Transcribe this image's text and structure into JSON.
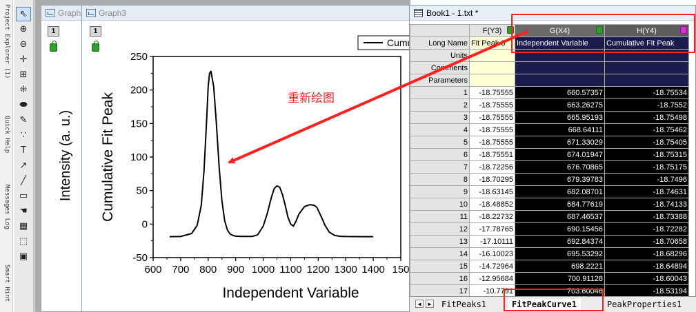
{
  "side_panels": [
    "Project Explorer (1)",
    "Quick Help",
    "Messages Log",
    "Smart Hint"
  ],
  "tools": [
    {
      "name": "pointer-icon",
      "glyph": "⇖"
    },
    {
      "name": "zoom-in-icon",
      "glyph": "⊕"
    },
    {
      "name": "zoom-out-icon",
      "glyph": "⊖"
    },
    {
      "name": "screen-reader-icon",
      "glyph": "✛"
    },
    {
      "name": "data-reader-icon",
      "glyph": "⊞"
    },
    {
      "name": "data-selector-icon",
      "glyph": "⁜"
    },
    {
      "name": "region-mask-icon",
      "glyph": "⬬"
    },
    {
      "name": "draw-data-icon",
      "glyph": "✎"
    },
    {
      "name": "scatter-icon",
      "glyph": "∵"
    },
    {
      "name": "text-tool-icon",
      "glyph": "T"
    },
    {
      "name": "arrow-tool-icon",
      "glyph": "↗"
    },
    {
      "name": "line-tool-icon",
      "glyph": "╱"
    },
    {
      "name": "rectangle-tool-icon",
      "glyph": "▭"
    },
    {
      "name": "hand-icon",
      "glyph": "☚"
    },
    {
      "name": "region-icon",
      "glyph": "▦"
    },
    {
      "name": "zoom-pan-icon",
      "glyph": "⬚"
    },
    {
      "name": "picture-icon",
      "glyph": "▣"
    }
  ],
  "graph2": {
    "title": "Graph",
    "layer": "1",
    "ylabel": "Intensity (a. u.)"
  },
  "graph3": {
    "title": "Graph3",
    "layer": "1",
    "legend": "Cumu"
  },
  "annotation_text": "重新绘图",
  "chart_data": {
    "type": "line",
    "title": "",
    "xlabel": "Independent Variable",
    "ylabel": "Cumulative Fit Peak",
    "xlim": [
      600,
      1500
    ],
    "ylim": [
      -50,
      250
    ],
    "xticks": [
      600,
      700,
      800,
      900,
      1000,
      1100,
      1200,
      1300,
      1400,
      1500
    ],
    "xtick_labels": [
      "600",
      "700",
      "800",
      "900",
      "1000",
      "1100",
      "1200",
      "1300",
      "1400",
      "150"
    ],
    "yticks": [
      -50,
      0,
      50,
      100,
      150,
      200,
      250
    ],
    "grid": false,
    "legend": "top-right",
    "series": [
      {
        "x": [
          660,
          700,
          740,
          760,
          775,
          785,
          795,
          800,
          805,
          810,
          820,
          830,
          840,
          850,
          860,
          870,
          880,
          890,
          900,
          920,
          940,
          960,
          980,
          1000,
          1015,
          1030,
          1040,
          1050,
          1060,
          1070,
          1080,
          1090,
          1100,
          1110,
          1120,
          1130,
          1150,
          1170,
          1185,
          1195,
          1210,
          1225,
          1240,
          1260,
          1280,
          1300,
          1330,
          1360,
          1400
        ],
        "y": [
          -18.8,
          -18.6,
          -14,
          -2,
          28,
          80,
          160,
          205,
          225,
          228,
          205,
          150,
          85,
          35,
          5,
          -9,
          -15,
          -17,
          -18,
          -18.4,
          -18.5,
          -18.5,
          -16,
          -3,
          16,
          40,
          53,
          57,
          55,
          44,
          28,
          10,
          0,
          -3,
          5,
          15,
          26,
          29,
          28,
          25,
          12,
          -2,
          -12,
          -17,
          -18.3,
          -18.6,
          -18.7,
          -18.75,
          -18.75
        ]
      }
    ]
  },
  "book": {
    "title": "Book1 - 1.txt *",
    "columns": [
      {
        "header": "F(Y3)",
        "long_name": "Fit Peak 3"
      },
      {
        "header": "G(X4)",
        "long_name": "Independent Variable"
      },
      {
        "header": "H(Y4)",
        "long_name": "Cumulative Fit Peak"
      }
    ],
    "labels": [
      "Long Name",
      "Units",
      "Comments",
      "Parameters"
    ],
    "rows": [
      {
        "n": "1",
        "f": "-18.75555",
        "g": "660.57357",
        "h": "-18.75534"
      },
      {
        "n": "2",
        "f": "-18.75555",
        "g": "663.26275",
        "h": "-18.7552"
      },
      {
        "n": "3",
        "f": "-18.75555",
        "g": "665.95193",
        "h": "-18.75498"
      },
      {
        "n": "4",
        "f": "-18.75555",
        "g": "668.64111",
        "h": "-18.75462"
      },
      {
        "n": "5",
        "f": "-18.75555",
        "g": "671.33029",
        "h": "-18.75405"
      },
      {
        "n": "6",
        "f": "-18.75551",
        "g": "674.01947",
        "h": "-18.75315"
      },
      {
        "n": "7",
        "f": "-18.72256",
        "g": "676.70865",
        "h": "-18.75175"
      },
      {
        "n": "8",
        "f": "-18.70295",
        "g": "679.39783",
        "h": "-18.7496"
      },
      {
        "n": "9",
        "f": "-18.63145",
        "g": "682.08701",
        "h": "-18.74631"
      },
      {
        "n": "10",
        "f": "-18.48852",
        "g": "684.77619",
        "h": "-18.74133"
      },
      {
        "n": "11",
        "f": "-18.22732",
        "g": "687.46537",
        "h": "-18.73388"
      },
      {
        "n": "12",
        "f": "-17.78765",
        "g": "690.15456",
        "h": "-18.72282"
      },
      {
        "n": "13",
        "f": "-17.10111",
        "g": "692.84374",
        "h": "-18.70658"
      },
      {
        "n": "14",
        "f": "-16.10023",
        "g": "695.53292",
        "h": "-18.68296"
      },
      {
        "n": "15",
        "f": "-14.72964",
        "g": "698.2221",
        "h": "-18.64894"
      },
      {
        "n": "16",
        "f": "-12.95684",
        "g": "700.91128",
        "h": "-18.60043"
      },
      {
        "n": "17",
        "f": "-10.7791",
        "g": "703.60046",
        "h": "-18.53194"
      }
    ],
    "tabs": [
      "FitPeaks1",
      "FitPeakCurve1",
      "PeakProperties1"
    ],
    "active_tab": "FitPeakCurve1"
  },
  "colors": {
    "annotation_red": "#ff2020",
    "selected_column_bg": "#000000",
    "label_row_bg": "#1b1b4e",
    "fit_column_bg": "#ffffd6"
  }
}
